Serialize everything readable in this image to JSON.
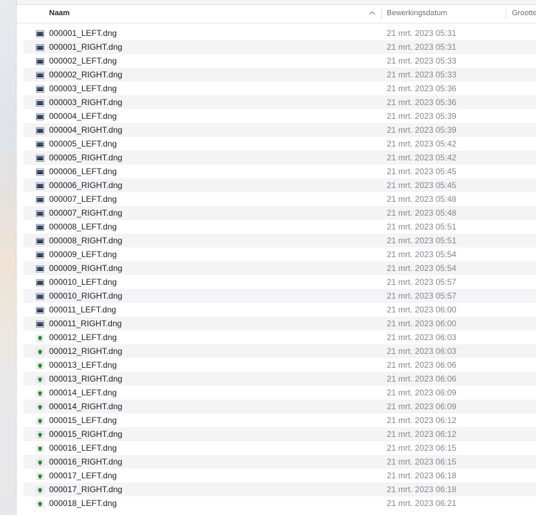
{
  "header": {
    "name_label": "Naam",
    "date_label": "Bewerkingsdatum",
    "size_label": "Grootte",
    "sort_icon": "chevron-up-icon"
  },
  "files": [
    {
      "name": "000001_LEFT.dng",
      "date": "21 mrt. 2023 05:31",
      "icon": "image-thumbnail-icon"
    },
    {
      "name": "000001_RIGHT.dng",
      "date": "21 mrt. 2023 05:31",
      "icon": "image-thumbnail-icon"
    },
    {
      "name": "000002_LEFT.dng",
      "date": "21 mrt. 2023 05:33",
      "icon": "image-thumbnail-icon"
    },
    {
      "name": "000002_RIGHT.dng",
      "date": "21 mrt. 2023 05:33",
      "icon": "image-thumbnail-icon"
    },
    {
      "name": "000003_LEFT.dng",
      "date": "21 mrt. 2023 05:36",
      "icon": "image-thumbnail-icon"
    },
    {
      "name": "000003_RIGHT.dng",
      "date": "21 mrt. 2023 05:36",
      "icon": "image-thumbnail-icon"
    },
    {
      "name": "000004_LEFT.dng",
      "date": "21 mrt. 2023 05:39",
      "icon": "image-thumbnail-icon"
    },
    {
      "name": "000004_RIGHT.dng",
      "date": "21 mrt. 2023 05:39",
      "icon": "image-thumbnail-icon"
    },
    {
      "name": "000005_LEFT.dng",
      "date": "21 mrt. 2023 05:42",
      "icon": "image-thumbnail-icon"
    },
    {
      "name": "000005_RIGHT.dng",
      "date": "21 mrt. 2023 05:42",
      "icon": "image-thumbnail-icon"
    },
    {
      "name": "000006_LEFT.dng",
      "date": "21 mrt. 2023 05:45",
      "icon": "image-thumbnail-icon"
    },
    {
      "name": "000006_RIGHT.dng",
      "date": "21 mrt. 2023 05:45",
      "icon": "image-thumbnail-icon"
    },
    {
      "name": "000007_LEFT.dng",
      "date": "21 mrt. 2023 05:48",
      "icon": "image-thumbnail-icon"
    },
    {
      "name": "000007_RIGHT.dng",
      "date": "21 mrt. 2023 05:48",
      "icon": "image-thumbnail-icon"
    },
    {
      "name": "000008_LEFT.dng",
      "date": "21 mrt. 2023 05:51",
      "icon": "image-thumbnail-icon"
    },
    {
      "name": "000008_RIGHT.dng",
      "date": "21 mrt. 2023 05:51",
      "icon": "image-thumbnail-icon"
    },
    {
      "name": "000009_LEFT.dng",
      "date": "21 mrt. 2023 05:54",
      "icon": "image-thumbnail-icon"
    },
    {
      "name": "000009_RIGHT.dng",
      "date": "21 mrt. 2023 05:54",
      "icon": "image-thumbnail-icon"
    },
    {
      "name": "000010_LEFT.dng",
      "date": "21 mrt. 2023 05:57",
      "icon": "image-thumbnail-icon"
    },
    {
      "name": "000010_RIGHT.dng",
      "date": "21 mrt. 2023 05:57",
      "icon": "image-thumbnail-icon"
    },
    {
      "name": "000011_LEFT.dng",
      "date": "21 mrt. 2023 06:00",
      "icon": "image-thumbnail-icon"
    },
    {
      "name": "000011_RIGHT.dng",
      "date": "21 mrt. 2023 06:00",
      "icon": "image-thumbnail-icon"
    },
    {
      "name": "000012_LEFT.dng",
      "date": "21 mrt. 2023 06:03",
      "icon": "green-shield-icon"
    },
    {
      "name": "000012_RIGHT.dng",
      "date": "21 mrt. 2023 06:03",
      "icon": "green-shield-icon"
    },
    {
      "name": "000013_LEFT.dng",
      "date": "21 mrt. 2023 06:06",
      "icon": "green-shield-icon"
    },
    {
      "name": "000013_RIGHT.dng",
      "date": "21 mrt. 2023 06:06",
      "icon": "green-shield-icon"
    },
    {
      "name": "000014_LEFT.dng",
      "date": "21 mrt. 2023 06:09",
      "icon": "green-shield-icon"
    },
    {
      "name": "000014_RIGHT.dng",
      "date": "21 mrt. 2023 06:09",
      "icon": "green-shield-icon"
    },
    {
      "name": "000015_LEFT.dng",
      "date": "21 mrt. 2023 06:12",
      "icon": "green-shield-icon"
    },
    {
      "name": "000015_RIGHT.dng",
      "date": "21 mrt. 2023 06:12",
      "icon": "green-shield-icon"
    },
    {
      "name": "000016_LEFT.dng",
      "date": "21 mrt. 2023 06:15",
      "icon": "green-shield-icon"
    },
    {
      "name": "000016_RIGHT.dng",
      "date": "21 mrt. 2023 06:15",
      "icon": "green-shield-icon"
    },
    {
      "name": "000017_LEFT.dng",
      "date": "21 mrt. 2023 06:18",
      "icon": "green-shield-icon"
    },
    {
      "name": "000017_RIGHT.dng",
      "date": "21 mrt. 2023 06:18",
      "icon": "green-shield-icon"
    },
    {
      "name": "000018_LEFT.dng",
      "date": "21 mrt. 2023 06:21",
      "icon": "green-shield-icon"
    }
  ],
  "colors": {
    "stripe": "#f4f4f6",
    "date_text": "#86868b",
    "shield_green": "#2e8b3a"
  }
}
